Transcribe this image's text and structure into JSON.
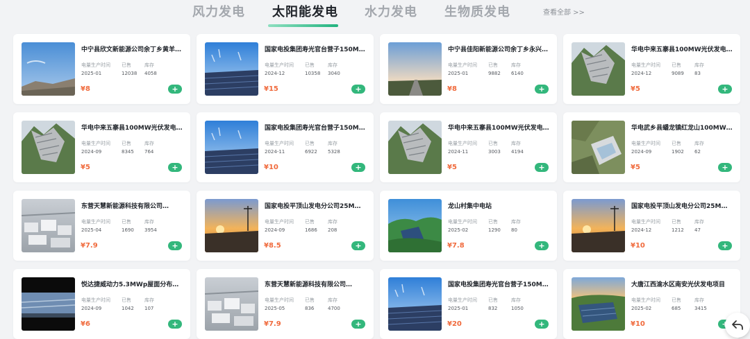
{
  "tabs": [
    {
      "label": "风力发电",
      "active": false
    },
    {
      "label": "太阳能发电",
      "active": true
    },
    {
      "label": "水力发电",
      "active": false
    },
    {
      "label": "生物质发电",
      "active": false
    }
  ],
  "view_all": "查看全部 >>",
  "stat_labels": {
    "date": "电量生产时间",
    "sold": "已售",
    "stock": "库存"
  },
  "add_icon": "plus-icon",
  "colors": {
    "accent": "#33b77c",
    "price": "#f06a3c",
    "tab_active": "#1f2329",
    "tab_inactive": "#a3a7ad"
  },
  "products": [
    {
      "title": "中宁县欣文新能源公司余丁乡黄羊…",
      "date": "2025-01",
      "sold": "12038",
      "stock": "4058",
      "price": "¥8",
      "image": "sky-landscape"
    },
    {
      "title": "国家电投集团寿光官台营子150M…",
      "date": "2024-12",
      "sold": "10358",
      "stock": "3040",
      "price": "¥15",
      "image": "solar-panels-sky"
    },
    {
      "title": "中宁县佳阳新能源公司余丁乡永兴…",
      "date": "2025-01",
      "sold": "9882",
      "stock": "6140",
      "price": "¥8",
      "image": "road-sunset"
    },
    {
      "title": "华电中来五寨县100MW光伏发电…",
      "date": "2024-12",
      "sold": "9089",
      "stock": "83",
      "price": "¥5",
      "image": "mountain-solar"
    },
    {
      "title": "华电中来五寨县100MW光伏发电…",
      "date": "2024-09",
      "sold": "8345",
      "stock": "764",
      "price": "¥5",
      "image": "mountain-solar"
    },
    {
      "title": "国家电投集团寿光官台营子150M…",
      "date": "2024-11",
      "sold": "6922",
      "stock": "5328",
      "price": "¥10",
      "image": "solar-panels-sky"
    },
    {
      "title": "华电中来五寨县100MW光伏发电…",
      "date": "2024-11",
      "sold": "3003",
      "stock": "4194",
      "price": "¥5",
      "image": "mountain-solar"
    },
    {
      "title": "华电武乡县蟠龙镇红龙山100MW…",
      "date": "2024-09",
      "sold": "1902",
      "stock": "62",
      "price": "¥5",
      "image": "aerial-facility"
    },
    {
      "title": "东营天慧新能源科技有限公司…",
      "date": "2025-04",
      "sold": "1690",
      "stock": "3954",
      "price": "¥7.9",
      "image": "rooftop-buildings"
    },
    {
      "title": "国家电投平顶山发电分公司25MW…",
      "date": "2024-09",
      "sold": "1686",
      "stock": "208",
      "price": "¥8.5",
      "image": "sunset-panels"
    },
    {
      "title": "龙山村集中电站",
      "date": "2025-02",
      "sold": "1290",
      "stock": "80",
      "price": "¥7.8",
      "image": "green-hills-solar"
    },
    {
      "title": "国家电投平顶山发电分公司25MW…",
      "date": "2024-12",
      "sold": "1212",
      "stock": "47",
      "price": "¥10",
      "image": "sunset-panels"
    },
    {
      "title": "悦达捷威动力5.3MWp屋面分布式…",
      "date": "2024-09",
      "sold": "1042",
      "stock": "107",
      "price": "¥6",
      "image": "rooftop-dark"
    },
    {
      "title": "东营天慧新能源科技有限公司…",
      "date": "2025-05",
      "sold": "836",
      "stock": "4700",
      "price": "¥7.9",
      "image": "rooftop-buildings"
    },
    {
      "title": "国家电投集团寿光官台营子150M…",
      "date": "2025-01",
      "sold": "832",
      "stock": "1050",
      "price": "¥20",
      "image": "solar-panels-sky"
    },
    {
      "title": "大唐江西渝水区南安光伏发电项目",
      "date": "2025-02",
      "sold": "685",
      "stock": "3415",
      "price": "¥10",
      "image": "lake-solar"
    }
  ],
  "float_button_icon": "back-arrow-icon"
}
